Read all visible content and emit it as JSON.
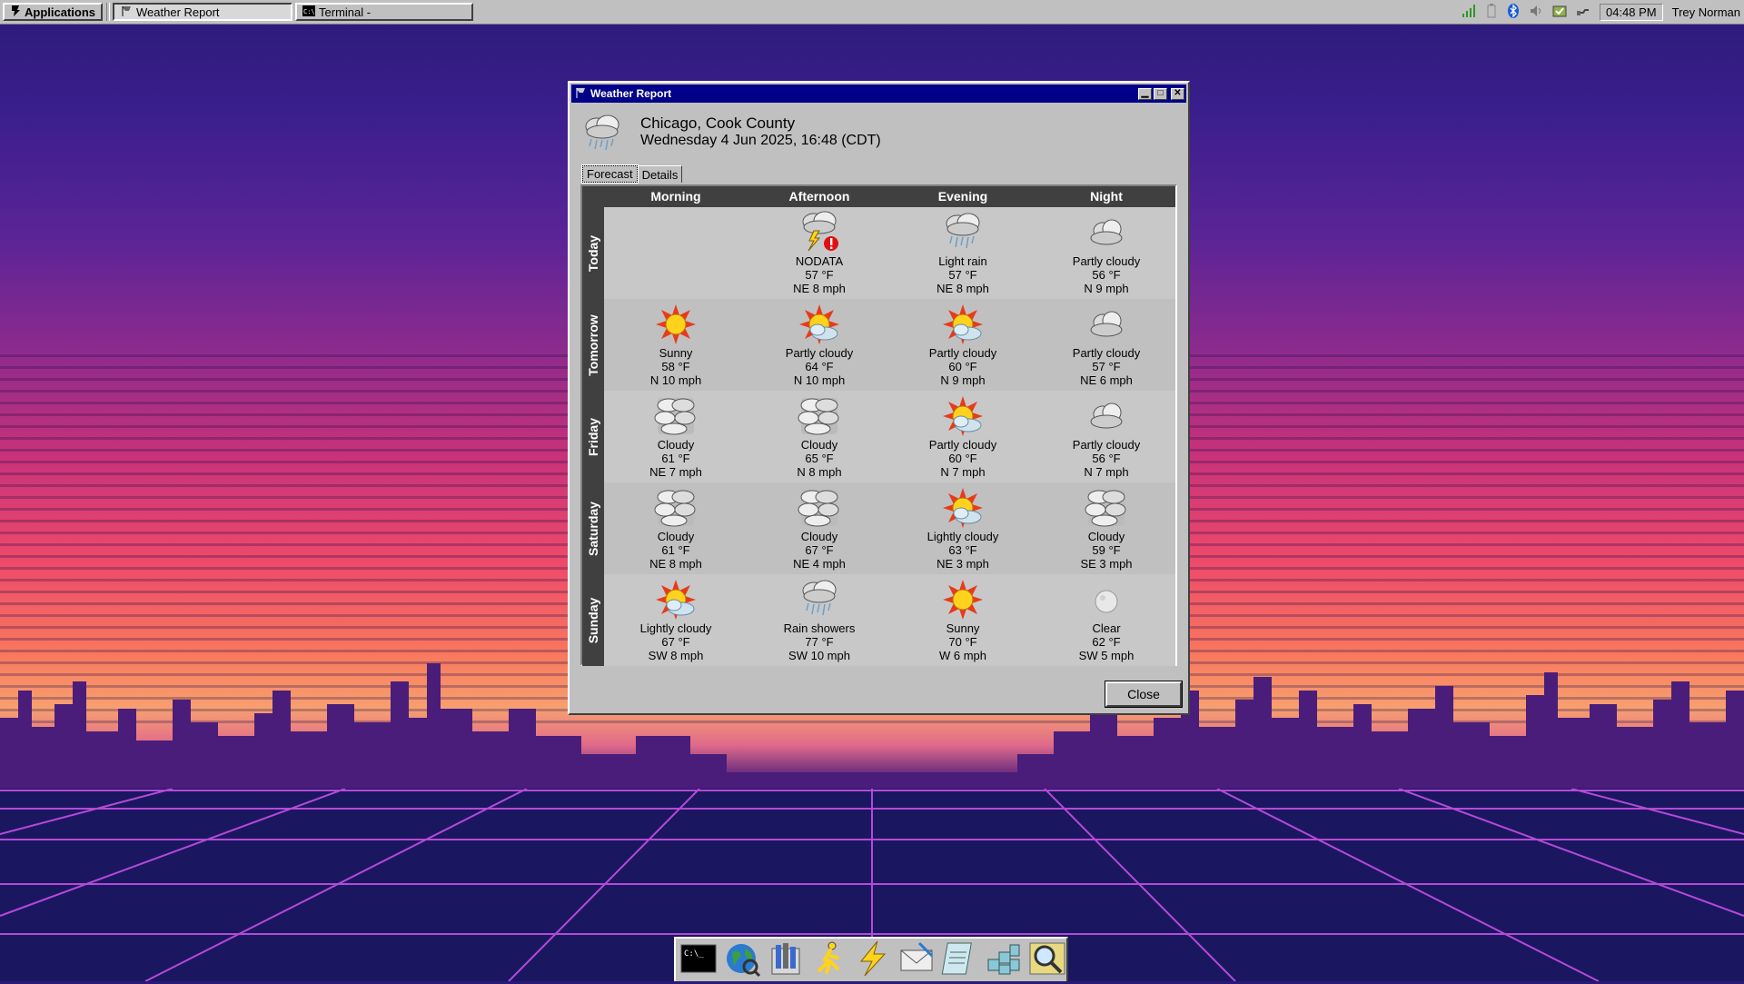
{
  "taskbar": {
    "apps_label": "Applications",
    "windows": [
      {
        "label": "Weather Report",
        "active": true
      },
      {
        "label": "Terminal -",
        "active": false
      }
    ],
    "clock": "04:48 PM",
    "user": "Trey Norman"
  },
  "window": {
    "title": "Weather Report",
    "location": "Chicago, Cook County",
    "datetime": "Wednesday  4 Jun 2025, 16:48 (CDT)",
    "tabs": [
      "Forecast",
      "Details"
    ],
    "close_label": "Close"
  },
  "forecast": {
    "columns": [
      "Morning",
      "Afternoon",
      "Evening",
      "Night"
    ],
    "rows": [
      {
        "label": "Today",
        "cells": [
          null,
          {
            "icon": "storm-alert",
            "desc": "NODATA",
            "temp": "57 °F",
            "wind": "NE 8 mph"
          },
          {
            "icon": "rain",
            "desc": "Light rain",
            "temp": "57 °F",
            "wind": "NE 8 mph"
          },
          {
            "icon": "partly-cloudy-night",
            "desc": "Partly cloudy",
            "temp": "56 °F",
            "wind": "N 9 mph"
          }
        ]
      },
      {
        "label": "Tomorrow",
        "cells": [
          {
            "icon": "sun",
            "desc": "Sunny",
            "temp": "58 °F",
            "wind": "N 10 mph"
          },
          {
            "icon": "sun-cloud",
            "desc": "Partly cloudy",
            "temp": "64 °F",
            "wind": "N 10 mph"
          },
          {
            "icon": "sun-cloud",
            "desc": "Partly cloudy",
            "temp": "60 °F",
            "wind": "N 9 mph"
          },
          {
            "icon": "partly-cloudy-night",
            "desc": "Partly cloudy",
            "temp": "57 °F",
            "wind": "NE 6 mph"
          }
        ]
      },
      {
        "label": "Friday",
        "cells": [
          {
            "icon": "cloudy",
            "desc": "Cloudy",
            "temp": "61 °F",
            "wind": "NE 7 mph"
          },
          {
            "icon": "cloudy",
            "desc": "Cloudy",
            "temp": "65 °F",
            "wind": "N 8 mph"
          },
          {
            "icon": "sun-cloud",
            "desc": "Partly cloudy",
            "temp": "60 °F",
            "wind": "N 7 mph"
          },
          {
            "icon": "partly-cloudy-night",
            "desc": "Partly cloudy",
            "temp": "56 °F",
            "wind": "N 7 mph"
          }
        ]
      },
      {
        "label": "Saturday",
        "cells": [
          {
            "icon": "cloudy",
            "desc": "Cloudy",
            "temp": "61 °F",
            "wind": "NE 8 mph"
          },
          {
            "icon": "cloudy",
            "desc": "Cloudy",
            "temp": "67 °F",
            "wind": "NE 4 mph"
          },
          {
            "icon": "sun-cloud",
            "desc": "Lightly cloudy",
            "temp": "63 °F",
            "wind": "NE 3 mph"
          },
          {
            "icon": "cloudy",
            "desc": "Cloudy",
            "temp": "59 °F",
            "wind": "SE 3 mph"
          }
        ]
      },
      {
        "label": "Sunday",
        "cells": [
          {
            "icon": "sun-cloud",
            "desc": "Lightly cloudy",
            "temp": "67 °F",
            "wind": "SW 8 mph"
          },
          {
            "icon": "rain",
            "desc": "Rain showers",
            "temp": "77 °F",
            "wind": "SW 10 mph"
          },
          {
            "icon": "sun",
            "desc": "Sunny",
            "temp": "70 °F",
            "wind": "W 6 mph"
          },
          {
            "icon": "moon",
            "desc": "Clear",
            "temp": "62 °F",
            "wind": "SW 5 mph"
          }
        ]
      }
    ]
  },
  "dock": [
    "terminal-icon",
    "browser-icon",
    "file-manager-icon",
    "runner-icon",
    "lightning-icon",
    "mail-icon",
    "notepad-icon",
    "package-icon",
    "search-icon"
  ]
}
